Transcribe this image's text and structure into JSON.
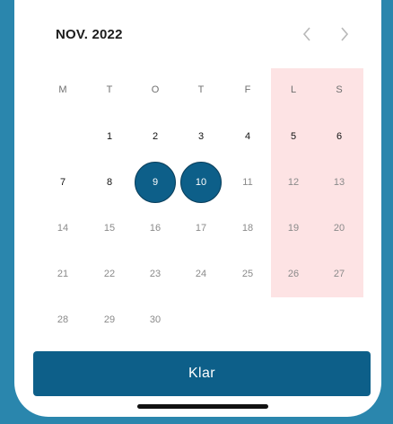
{
  "calendar": {
    "month_label": "NOV. 2022",
    "weekdays": [
      "M",
      "T",
      "O",
      "T",
      "F",
      "L",
      "S"
    ],
    "rows": [
      [
        "",
        "1",
        "2",
        "3",
        "4",
        "5",
        "6"
      ],
      [
        "7",
        "8",
        "9",
        "10",
        "11",
        "12",
        "13"
      ],
      [
        "14",
        "15",
        "16",
        "17",
        "18",
        "19",
        "20"
      ],
      [
        "21",
        "22",
        "23",
        "24",
        "25",
        "26",
        "27"
      ],
      [
        "28",
        "29",
        "30",
        "",
        "",
        "",
        ""
      ]
    ],
    "selected_days": [
      "9",
      "10"
    ],
    "prev_icon": "chevron-left-icon",
    "next_icon": "chevron-right-icon"
  },
  "footer": {
    "done_label": "Klar"
  },
  "colors": {
    "accent": "#0d5f89",
    "weekend_highlight": "#fde3e4",
    "frame": "#2a86ad"
  }
}
